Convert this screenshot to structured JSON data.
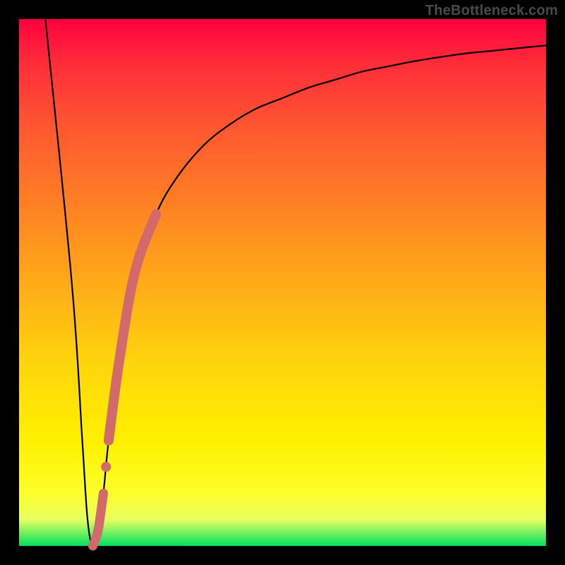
{
  "watermark": "TheBottleneck.com",
  "chart_data": {
    "type": "line",
    "title": "",
    "xlabel": "",
    "ylabel": "",
    "xlim": [
      0,
      100
    ],
    "ylim": [
      0,
      100
    ],
    "series": [
      {
        "name": "bottleneck-curve",
        "x": [
          5,
          10,
          12,
          13,
          14,
          15,
          16,
          17,
          19,
          22,
          26,
          30,
          35,
          40,
          45,
          50,
          55,
          60,
          65,
          70,
          75,
          80,
          85,
          90,
          95,
          100
        ],
        "values": [
          100,
          50,
          20,
          5,
          0,
          3,
          10,
          20,
          35,
          52,
          63,
          70,
          76,
          80,
          83,
          85,
          87,
          88.5,
          90,
          91,
          92,
          92.8,
          93.5,
          94,
          94.5,
          95
        ]
      }
    ],
    "highlight_segment": {
      "name": "highlighted-range",
      "color": "#d2696b",
      "x": [
        14,
        15,
        16,
        17,
        19,
        22,
        26
      ],
      "values": [
        0,
        3,
        10,
        20,
        35,
        52,
        63
      ]
    }
  }
}
